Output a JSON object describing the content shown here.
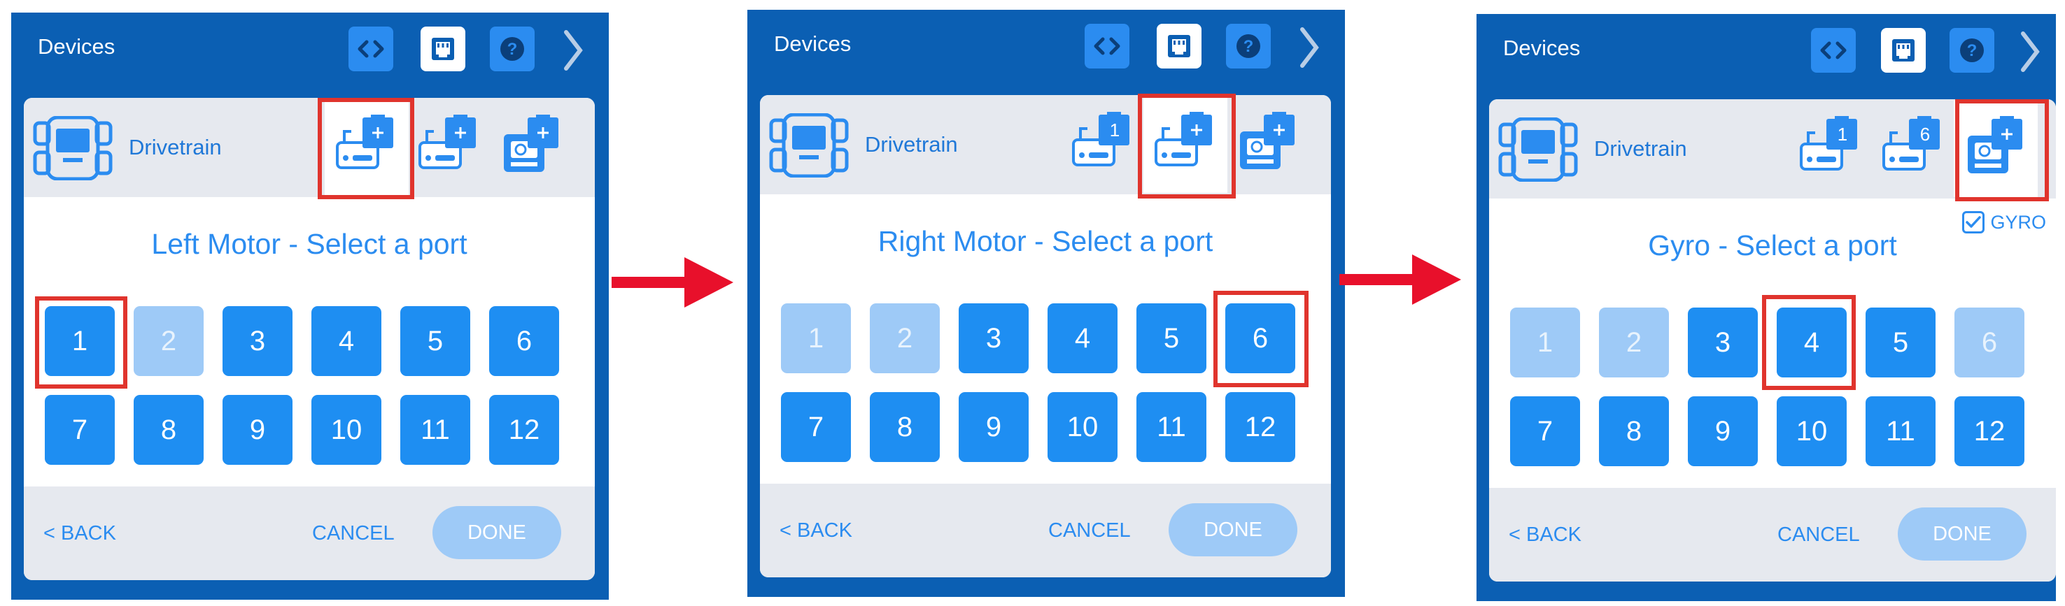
{
  "colors": {
    "panel": "#0b5fb3",
    "accent": "#2b8cf0",
    "port_enabled": "#1e8ef2",
    "port_disabled": "#9ecaf7",
    "highlight": "#e0342d",
    "arrow": "#e8102b"
  },
  "panels": [
    {
      "title": "Devices",
      "drivetrain_label": "Drivetrain",
      "heading": "Left Motor - Select a port",
      "slot_badges": [
        "",
        "",
        ""
      ],
      "gyro_checkbox": "",
      "ports": [
        "1",
        "2",
        "3",
        "4",
        "5",
        "6",
        "7",
        "8",
        "9",
        "10",
        "11",
        "12"
      ],
      "selected_port": "1",
      "back": "< BACK",
      "cancel": "CANCEL",
      "done": "DONE"
    },
    {
      "title": "Devices",
      "drivetrain_label": "Drivetrain",
      "heading": "Right Motor - Select a port",
      "slot_badges": [
        "1",
        "",
        ""
      ],
      "gyro_checkbox": "",
      "ports": [
        "1",
        "2",
        "3",
        "4",
        "5",
        "6",
        "7",
        "8",
        "9",
        "10",
        "11",
        "12"
      ],
      "selected_port": "6",
      "back": "< BACK",
      "cancel": "CANCEL",
      "done": "DONE"
    },
    {
      "title": "Devices",
      "drivetrain_label": "Drivetrain",
      "heading": "Gyro - Select a port",
      "slot_badges": [
        "1",
        "6",
        ""
      ],
      "gyro_checkbox": "GYRO",
      "ports": [
        "1",
        "2",
        "3",
        "4",
        "5",
        "6",
        "7",
        "8",
        "9",
        "10",
        "11",
        "12"
      ],
      "selected_port": "4",
      "back": "< BACK",
      "cancel": "CANCEL",
      "done": "DONE"
    }
  ]
}
